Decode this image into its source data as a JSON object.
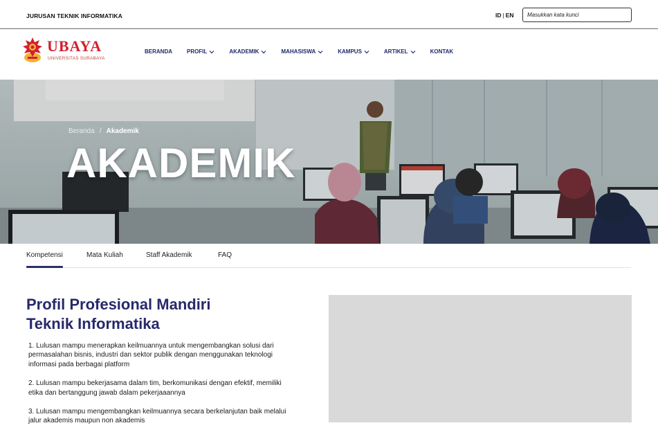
{
  "topbar": {
    "department": "JURUSAN TEKNIK INFORMATIKA",
    "lang_id": "ID",
    "lang_separator": "|",
    "lang_en": "EN",
    "search_placeholder": "Masukkan kata kunci"
  },
  "header": {
    "logo_text": "UBAYA",
    "logo_subtext": "UNIVERSITAS SURABAYA",
    "brand_color": "#d3202f",
    "nav": [
      {
        "label": "BERANDA",
        "dropdown": false
      },
      {
        "label": "PROFIL",
        "dropdown": true
      },
      {
        "label": "AKADEMIK",
        "dropdown": true
      },
      {
        "label": "MAHASISWA",
        "dropdown": true
      },
      {
        "label": "KAMPUS",
        "dropdown": true
      },
      {
        "label": "ARTIKEL",
        "dropdown": true
      },
      {
        "label": "KONTAK",
        "dropdown": false
      }
    ]
  },
  "hero": {
    "breadcrumb_home": "Beranda",
    "breadcrumb_separator": "/",
    "breadcrumb_current": "Akademik",
    "title": "AKADEMIK"
  },
  "tabs": [
    {
      "label": "Kompetensi",
      "active": true
    },
    {
      "label": "Mata Kuliah",
      "active": false
    },
    {
      "label": "Staff Akademik",
      "active": false
    },
    {
      "label": "FAQ",
      "active": false
    }
  ],
  "content": {
    "heading_line1": "Profil Profesional Mandiri",
    "heading_line2": "Teknik Informatika",
    "heading_color": "#27296b",
    "items": [
      "1. Lulusan mampu menerapkan keilmuannya untuk mengembangkan solusi dari permasalahan bisnis, industri dan sektor publik dengan menggunakan teknologi informasi pada berbagai platform",
      "2. Lulusan mampu bekerjasama dalam tim, berkomunikasi dengan efektif, memiliki etika dan bertanggung jawab dalam pekerjaaannya",
      "3. Lulusan mampu mengembangkan keilmuannya secara berkelanjutan baik melalui jalur akademis maupun non akademis"
    ],
    "image_placeholder_color": "#d9d9d9"
  }
}
